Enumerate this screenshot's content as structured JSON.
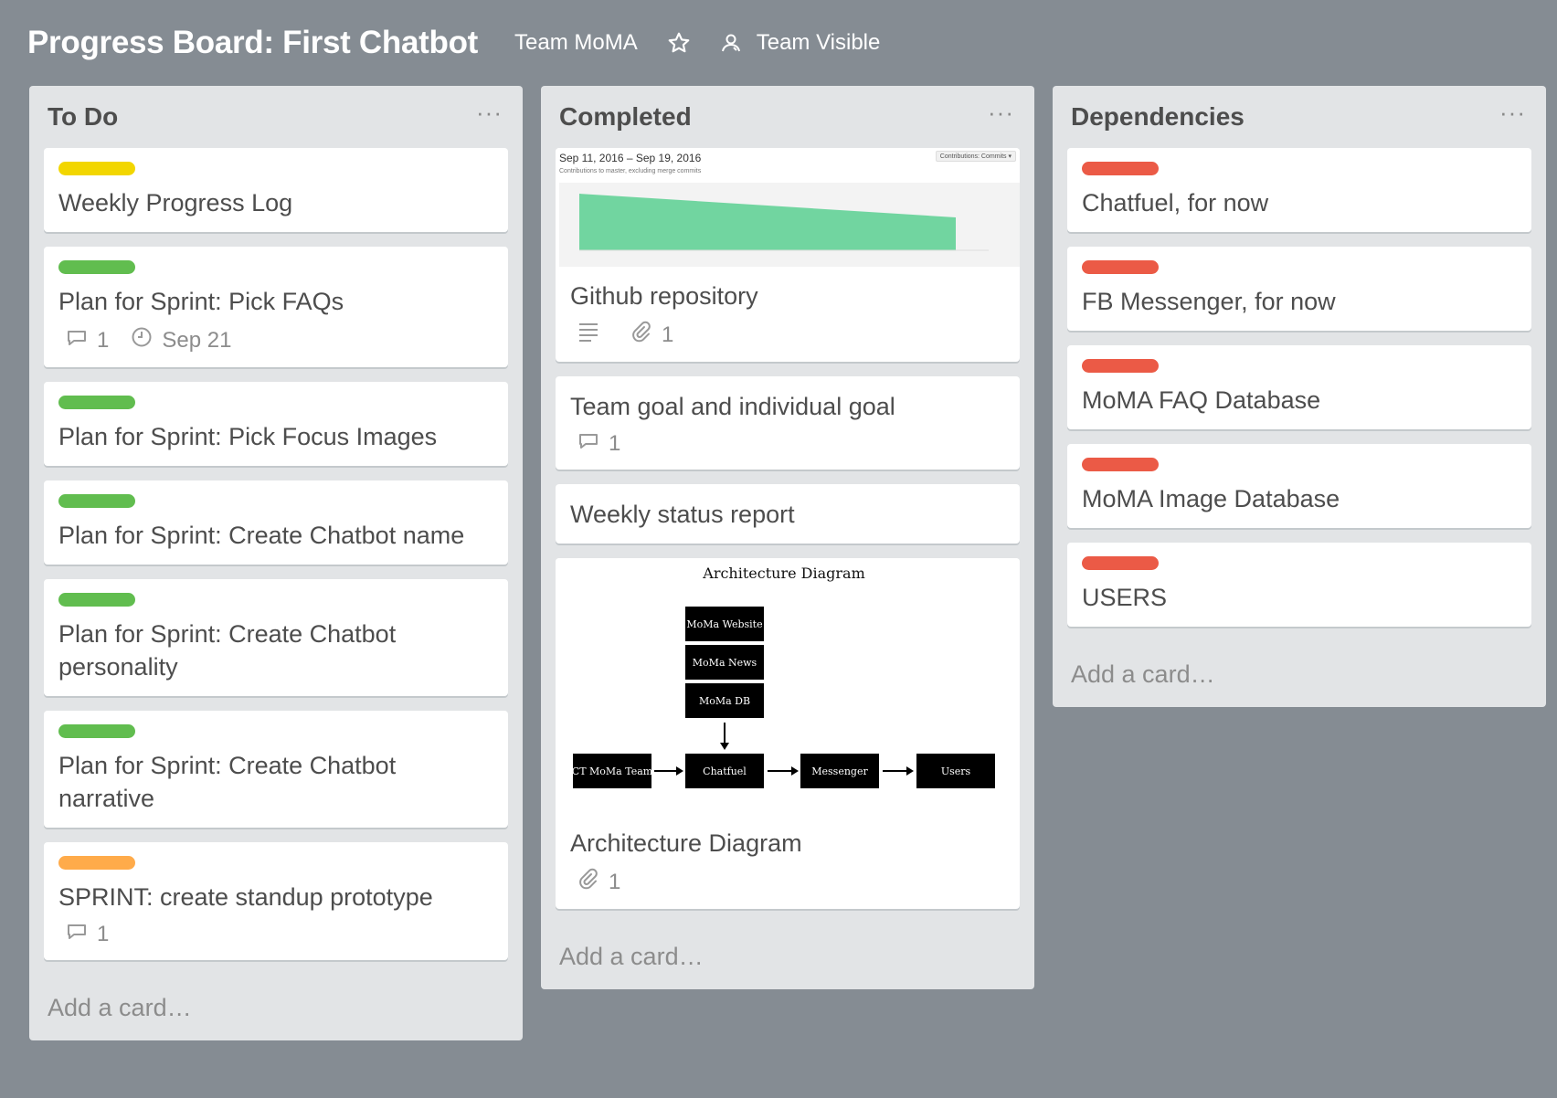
{
  "board": {
    "title": "Progress Board: First Chatbot",
    "team": "Team MoMA",
    "visibility": "Team Visible"
  },
  "colors": {
    "board_bg": "#858c93",
    "yellow": "#f2d600",
    "green": "#61bd4f",
    "orange": "#ffab4a",
    "red": "#eb5a46",
    "chart_fill": "#71d5a0"
  },
  "icons": {
    "star": "star-icon",
    "visibility": "team-visible-icon",
    "comment": "comment-icon",
    "clock": "clock-icon",
    "description": "description-icon",
    "attachment": "attachment-icon"
  },
  "lists": {
    "todo": {
      "title": "To Do",
      "menu": "···",
      "add_card": "Add a card…",
      "cards": [
        {
          "label_color": "yellow",
          "title": "Weekly Progress Log"
        },
        {
          "label_color": "green",
          "title": "Plan for Sprint: Pick FAQs",
          "comments": "1",
          "due": "Sep 21"
        },
        {
          "label_color": "green",
          "title": "Plan for Sprint: Pick Focus Images"
        },
        {
          "label_color": "green",
          "title": "Plan for Sprint: Create Chatbot name"
        },
        {
          "label_color": "green",
          "title": "Plan for Sprint: Create Chatbot personality"
        },
        {
          "label_color": "green",
          "title": "Plan for Sprint: Create Chatbot narrative"
        },
        {
          "label_color": "orange",
          "title": "SPRINT: create standup prototype",
          "comments": "1"
        }
      ]
    },
    "completed": {
      "title": "Completed",
      "menu": "···",
      "add_card": "Add a card…",
      "cards": [
        {
          "title": "Github repository",
          "attachments": "1",
          "cover": {
            "range": "Sep 11, 2016 – Sep 19, 2016",
            "subtitle": "Contributions to master, excluding merge commits",
            "dropdown": "Contributions: Commits ▾"
          }
        },
        {
          "title": "Team goal and individual goal",
          "comments": "1"
        },
        {
          "title": "Weekly status report"
        },
        {
          "title": "Architecture Diagram",
          "attachments": "1",
          "cover": {
            "heading": "Architecture Diagram",
            "boxes": {
              "website": "MoMa Website",
              "news": "MoMa News",
              "db": "MoMa DB",
              "team": "CT MoMa Team",
              "chatfuel": "Chatfuel",
              "messenger": "Messenger",
              "users": "Users"
            }
          }
        }
      ]
    },
    "dependencies": {
      "title": "Dependencies",
      "menu": "···",
      "add_card": "Add a card…",
      "cards": [
        {
          "label_color": "red",
          "title": "Chatfuel, for now"
        },
        {
          "label_color": "red",
          "title": "FB Messenger, for now"
        },
        {
          "label_color": "red",
          "title": "MoMA FAQ Database"
        },
        {
          "label_color": "red",
          "title": "MoMA Image Database"
        },
        {
          "label_color": "red",
          "title": "USERS"
        }
      ]
    }
  }
}
